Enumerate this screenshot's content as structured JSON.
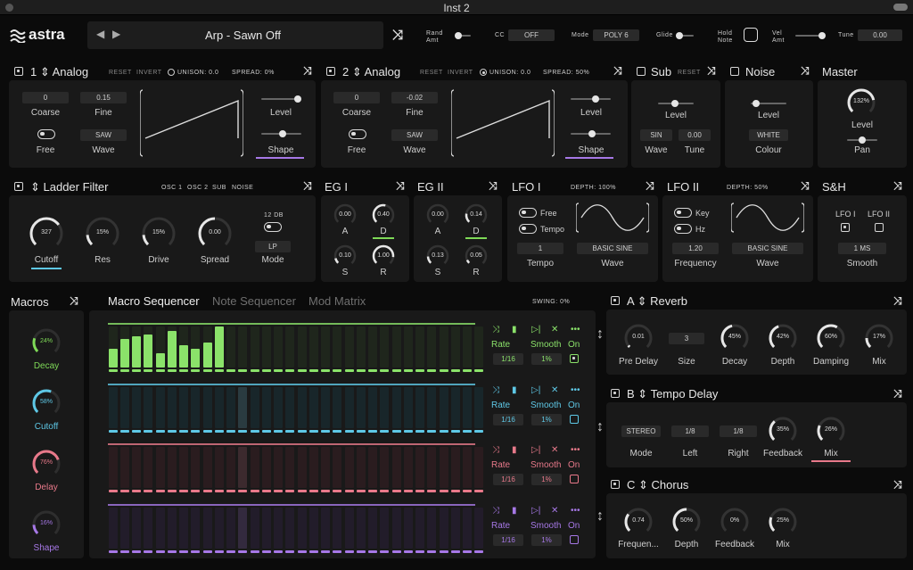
{
  "window": {
    "title": "Inst 2"
  },
  "topbar": {
    "logo": "astra",
    "preset": "Arp - Sawn Off",
    "rand_label": "Rand Amt",
    "cc_label": "CC",
    "cc_value": "OFF",
    "mode_label": "Mode",
    "mode_value": "POLY 6",
    "glide_label": "Glide",
    "hold_label": "Hold Note",
    "vel_label": "Vel Amt",
    "tune_label": "Tune",
    "tune_value": "0.00"
  },
  "osc1": {
    "num": "1",
    "name": "Analog",
    "reset": "RESET",
    "invert": "INVERT",
    "unison": "UNISON:",
    "unison_value": "0.0",
    "spread": "SPREAD:",
    "spread_value": "0%",
    "coarse": "0",
    "coarse_label": "Coarse",
    "fine": "0.15",
    "fine_label": "Fine",
    "free_label": "Free",
    "wave": "SAW",
    "wave_label": "Wave",
    "level_label": "Level",
    "shape_label": "Shape"
  },
  "osc2": {
    "num": "2",
    "name": "Analog",
    "reset": "RESET",
    "invert": "INVERT",
    "unison": "UNISON:",
    "unison_value": "0.0",
    "spread": "SPREAD:",
    "spread_value": "50%",
    "coarse": "0",
    "coarse_label": "Coarse",
    "fine": "-0.02",
    "fine_label": "Fine",
    "free_label": "Free",
    "wave": "SAW",
    "wave_label": "Wave",
    "level_label": "Level",
    "shape_label": "Shape"
  },
  "sub": {
    "name": "Sub",
    "reset": "RESET",
    "level_label": "Level",
    "wave": "SIN",
    "wave_label": "Wave",
    "tune": "0.00",
    "tune_label": "Tune"
  },
  "noise": {
    "name": "Noise",
    "level_label": "Level",
    "colour": "WHITE",
    "colour_label": "Colour"
  },
  "master": {
    "name": "Master",
    "level": "132%",
    "level_label": "Level",
    "pan_label": "Pan"
  },
  "filter": {
    "name": "Ladder Filter",
    "src1": "OSC 1",
    "src2": "OSC 2",
    "src3": "SUB",
    "src4": "NOISE",
    "cutoff": "327",
    "cutoff_label": "Cutoff",
    "res": "15%",
    "res_label": "Res",
    "drive": "15%",
    "drive_label": "Drive",
    "spread": "0.00",
    "spread_label": "Spread",
    "db": "12 DB",
    "mode": "LP",
    "mode_label": "Mode"
  },
  "eg1": {
    "name": "EG I",
    "a": "0.00",
    "d": "0.40",
    "s": "0.10",
    "r": "1.00",
    "al": "A",
    "dl": "D",
    "sl": "S",
    "rl": "R"
  },
  "eg2": {
    "name": "EG II",
    "a": "0.00",
    "d": "0.14",
    "s": "0.13",
    "r": "0.05",
    "al": "A",
    "dl": "D",
    "sl": "S",
    "rl": "R"
  },
  "lfo1": {
    "name": "LFO I",
    "depth": "DEPTH:",
    "depth_value": "100%",
    "free": "Free",
    "tempo_t": "Tempo",
    "tempo": "1",
    "tempo_label": "Tempo",
    "wave": "BASIC SINE",
    "wave_label": "Wave"
  },
  "lfo2": {
    "name": "LFO II",
    "depth": "DEPTH:",
    "depth_value": "50%",
    "key": "Key",
    "hz": "Hz",
    "freq": "1.20",
    "freq_label": "Frequency",
    "wave": "BASIC SINE",
    "wave_label": "Wave"
  },
  "sh": {
    "name": "S&H",
    "l1": "LFO I",
    "l2": "LFO II",
    "smooth": "1 MS",
    "smooth_label": "Smooth"
  },
  "macros": {
    "title": "Macros",
    "items": [
      {
        "value": "24%",
        "label": "Decay",
        "color": "#7ed957"
      },
      {
        "value": "58%",
        "label": "Cutoff",
        "color": "#5ec8e6"
      },
      {
        "value": "76%",
        "label": "Delay",
        "color": "#e8798a"
      },
      {
        "value": "16%",
        "label": "Shape",
        "color": "#a678e6"
      }
    ]
  },
  "seq": {
    "tab1": "Macro Sequencer",
    "tab2": "Note Sequencer",
    "tab3": "Mod Matrix",
    "swing": "SWING:",
    "swing_value": "0%",
    "lanes": [
      {
        "color": "#8be26a",
        "rate": "Rate",
        "smooth": "Smooth",
        "on": "On",
        "rate_v": "1/16",
        "smooth_v": "1%",
        "levels": [
          0.45,
          0.7,
          0.75,
          0.8,
          0.35,
          0.9,
          0.55,
          0.45,
          0.6,
          1,
          0,
          0,
          0,
          0,
          0,
          0,
          0,
          0,
          0,
          0,
          0,
          0,
          0,
          0,
          0,
          0,
          0,
          0,
          0,
          0,
          0,
          0
        ]
      },
      {
        "color": "#5ec8e6",
        "rate": "Rate",
        "smooth": "Smooth",
        "on": "On",
        "rate_v": "1/16",
        "smooth_v": "1%",
        "levels": []
      },
      {
        "color": "#e8798a",
        "rate": "Rate",
        "smooth": "Smooth",
        "on": "On",
        "rate_v": "1/16",
        "smooth_v": "1%",
        "levels": []
      },
      {
        "color": "#a678e6",
        "rate": "Rate",
        "smooth": "Smooth",
        "on": "On",
        "rate_v": "1/16",
        "smooth_v": "1%",
        "levels": []
      }
    ]
  },
  "reverb": {
    "slot": "A",
    "name": "Reverb",
    "predelay": "0.01",
    "predelay_label": "Pre Delay",
    "size": "3",
    "size_label": "Size",
    "decay": "45%",
    "decay_label": "Decay",
    "depth": "42%",
    "depth_label": "Depth",
    "damping": "60%",
    "damping_label": "Damping",
    "mix": "17%",
    "mix_label": "Mix"
  },
  "delay": {
    "slot": "B",
    "name": "Tempo Delay",
    "mode": "STEREO",
    "mode_label": "Mode",
    "left": "1/8",
    "left_label": "Left",
    "right": "1/8",
    "right_label": "Right",
    "feedback": "35%",
    "feedback_label": "Feedback",
    "mix": "26%",
    "mix_label": "Mix"
  },
  "chorus": {
    "slot": "C",
    "name": "Chorus",
    "freq": "0.74",
    "freq_label": "Frequen...",
    "depth": "50%",
    "depth_label": "Depth",
    "feedback": "0%",
    "feedback_label": "Feedback",
    "mix": "25%",
    "mix_label": "Mix"
  }
}
